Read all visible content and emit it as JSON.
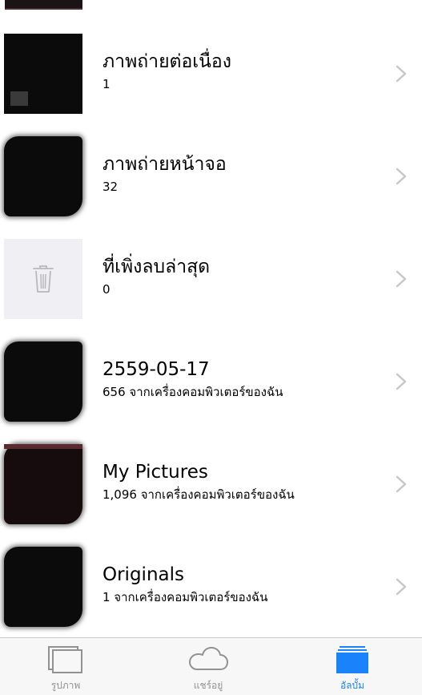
{
  "albums": [
    {
      "title": "ภาพถ่ายต่อเนื่อง",
      "count": "1"
    },
    {
      "title": "ภาพถ่ายหน้าจอ",
      "count": "32"
    },
    {
      "title": "ที่เพิ่งลบล่าสุด",
      "count": "0"
    },
    {
      "title": "2559-05-17",
      "count": "656 จากเครื่องคอมพิวเตอร์ของฉัน"
    },
    {
      "title": "My Pictures",
      "count": "1,096 จากเครื่องคอมพิวเตอร์ของฉัน"
    },
    {
      "title": "Originals",
      "count": "1 จากเครื่องคอมพิวเตอร์ของฉัน"
    }
  ],
  "tabs": [
    {
      "label": "รูปภาพ",
      "icon": "photos-icon",
      "active": false
    },
    {
      "label": "แชร์อยู่",
      "icon": "cloud-icon",
      "active": false
    },
    {
      "label": "อัลบั้ม",
      "icon": "albums-icon",
      "active": true
    }
  ],
  "colors": {
    "accent": "#1a82fb",
    "tab_inactive": "#929292",
    "chevron": "#c7c7cc",
    "trash_tile_bg": "#efeff4"
  }
}
